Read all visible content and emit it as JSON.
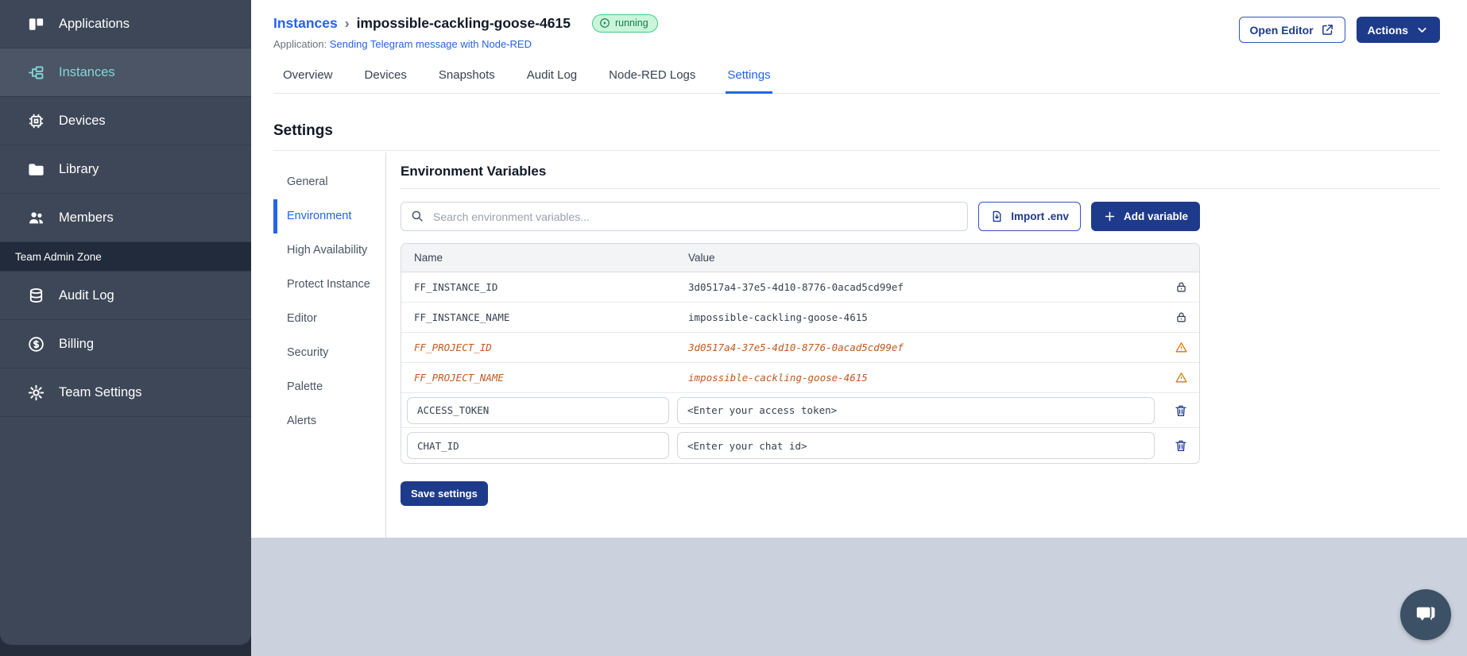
{
  "colors": {
    "accent_blue": "#2563eb",
    "navy_button": "#1e3a8a",
    "sidebar_teal": "#84d6d6",
    "sidebar_bg": "#3d4757",
    "badge_green_bg": "#c9f5da",
    "badge_green_text": "#1a7a50",
    "deprecated_orange": "#c05a21",
    "footer_gray": "#ccd2dd"
  },
  "sidebar": {
    "items": [
      {
        "label": "Applications",
        "icon": "applications-icon",
        "active": false
      },
      {
        "label": "Instances",
        "icon": "instances-icon",
        "active": true
      },
      {
        "label": "Devices",
        "icon": "chip-icon",
        "active": false
      },
      {
        "label": "Library",
        "icon": "folder-icon",
        "active": false
      },
      {
        "label": "Members",
        "icon": "users-icon",
        "active": false
      }
    ],
    "section_label": "Team Admin Zone",
    "admin_items": [
      {
        "label": "Audit Log",
        "icon": "database-icon",
        "active": false
      },
      {
        "label": "Billing",
        "icon": "dollar-icon",
        "active": false
      },
      {
        "label": "Team Settings",
        "icon": "gear-icon",
        "active": false
      }
    ]
  },
  "header": {
    "breadcrumb_root": "Instances",
    "breadcrumb_separator": "›",
    "instance_name": "impossible-cackling-goose-4615",
    "status_badge": "running",
    "application_label": "Application:",
    "application_link": "Sending Telegram message with Node-RED",
    "open_editor_label": "Open Editor",
    "actions_label": "Actions"
  },
  "tabs": [
    {
      "label": "Overview",
      "active": false
    },
    {
      "label": "Devices",
      "active": false
    },
    {
      "label": "Snapshots",
      "active": false
    },
    {
      "label": "Audit Log",
      "active": false
    },
    {
      "label": "Node-RED Logs",
      "active": false
    },
    {
      "label": "Settings",
      "active": true
    }
  ],
  "settings": {
    "title": "Settings",
    "nav": [
      {
        "label": "General",
        "active": false
      },
      {
        "label": "Environment",
        "active": true
      },
      {
        "label": "High Availability",
        "active": false
      },
      {
        "label": "Protect Instance",
        "active": false
      },
      {
        "label": "Editor",
        "active": false
      },
      {
        "label": "Security",
        "active": false
      },
      {
        "label": "Palette",
        "active": false
      },
      {
        "label": "Alerts",
        "active": false
      }
    ]
  },
  "env": {
    "title": "Environment Variables",
    "search_placeholder": "Search environment variables...",
    "import_label": "Import .env",
    "add_label": "Add variable",
    "columns": {
      "name": "Name",
      "value": "Value"
    },
    "rows": [
      {
        "name": "FF_INSTANCE_ID",
        "value": "3d0517a4-37e5-4d10-8776-0acad5cd99ef",
        "type": "locked"
      },
      {
        "name": "FF_INSTANCE_NAME",
        "value": "impossible-cackling-goose-4615",
        "type": "locked"
      },
      {
        "name": "FF_PROJECT_ID",
        "value": "3d0517a4-37e5-4d10-8776-0acad5cd99ef",
        "type": "deprecated"
      },
      {
        "name": "FF_PROJECT_NAME",
        "value": "impossible-cackling-goose-4615",
        "type": "deprecated"
      },
      {
        "name": "ACCESS_TOKEN",
        "value": "<Enter your access token>",
        "type": "editable"
      },
      {
        "name": "CHAT_ID",
        "value": "<Enter your chat id>",
        "type": "editable"
      }
    ],
    "save_label": "Save settings"
  }
}
